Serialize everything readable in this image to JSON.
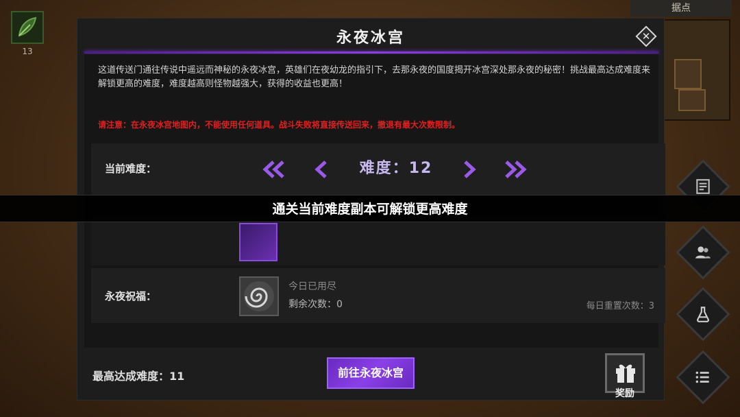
{
  "background": {
    "item_count": "13",
    "minimap_title": "据点"
  },
  "dialog": {
    "title": "永夜冰宫",
    "close_icon": "close-icon",
    "description": "这道传送门通往传说中遥远而神秘的永夜冰宫，英雄们在夜幼龙的指引下，去那永夜的国度揭开冰宫深处那永夜的秘密！挑战最高达成难度来解锁更高的难度，难度越高则怪物越强大，获得的收益也更高！",
    "warning": "请注意：在永夜冰宫地图内，不能使用任何道具。战斗失败将直接传送回来，撤退有最大次数限制。"
  },
  "difficulty": {
    "label": "当前难度：",
    "value_label": "难度：",
    "value": "12",
    "icons": [
      "double-chevron-left-icon",
      "chevron-left-icon",
      "chevron-right-icon",
      "double-chevron-right-icon"
    ]
  },
  "toast": {
    "message": "通关当前难度副本可解锁更高难度"
  },
  "blessing": {
    "label": "永夜祝福：",
    "status": "今日已用尽",
    "remaining": "剩余次数：0",
    "daily_reset": "每日重置次数：3"
  },
  "footer": {
    "max_difficulty": "最高达成难度：11",
    "go_button": "前往永夜冰宫",
    "reward_label": "奖励"
  },
  "colors": {
    "accent": "#8a40e8",
    "warning": "#e02020"
  }
}
